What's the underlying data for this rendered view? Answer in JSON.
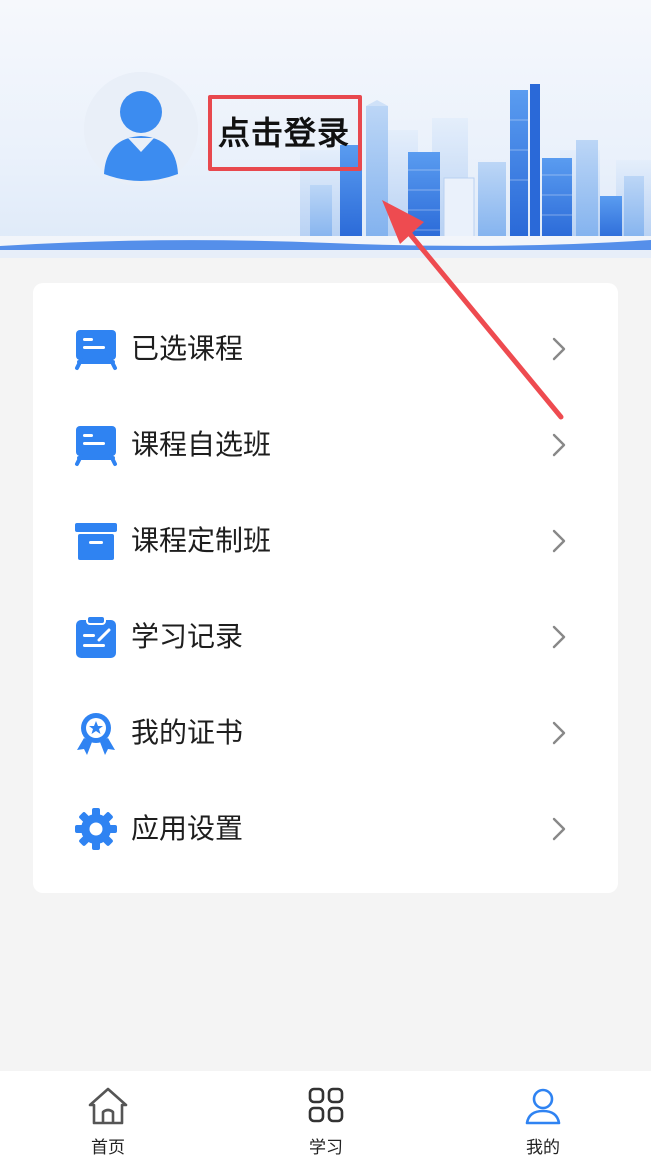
{
  "header": {
    "login_label": "点击登录"
  },
  "menu": {
    "items": [
      {
        "label": "已选课程",
        "icon": "course-board-icon"
      },
      {
        "label": "课程自选班",
        "icon": "course-board-icon"
      },
      {
        "label": "课程定制班",
        "icon": "archive-box-icon"
      },
      {
        "label": "学习记录",
        "icon": "clipboard-edit-icon"
      },
      {
        "label": "我的证书",
        "icon": "award-badge-icon"
      },
      {
        "label": "应用设置",
        "icon": "gear-icon"
      }
    ]
  },
  "tabbar": {
    "tabs": [
      {
        "label": "首页",
        "icon": "home-icon",
        "active": false
      },
      {
        "label": "学习",
        "icon": "grid-icon",
        "active": false
      },
      {
        "label": "我的",
        "icon": "user-icon",
        "active": true
      }
    ]
  },
  "colors": {
    "accent": "#2f83f2",
    "annotation_red": "#e8484e",
    "page_bg": "#f4f4f4"
  }
}
